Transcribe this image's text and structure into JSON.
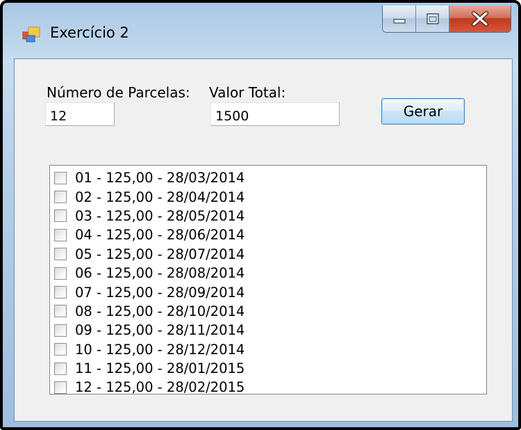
{
  "window": {
    "title": "Exercício 2",
    "icons": {
      "app": "forms-app-icon",
      "minimize": "minimize-icon",
      "maximize": "maximize-icon",
      "close": "close-icon"
    }
  },
  "form": {
    "parcelas_label": "Número de Parcelas:",
    "parcelas_value": "12",
    "valor_label": "Valor Total:",
    "valor_value": "1500",
    "gerar_label": "Gerar"
  },
  "list": {
    "items": [
      {
        "label": "01 - 125,00 - 28/03/2014",
        "checked": false
      },
      {
        "label": "02 - 125,00 - 28/04/2014",
        "checked": false
      },
      {
        "label": "03 - 125,00 - 28/05/2014",
        "checked": false
      },
      {
        "label": "04 - 125,00 - 28/06/2014",
        "checked": false
      },
      {
        "label": "05 - 125,00 - 28/07/2014",
        "checked": false
      },
      {
        "label": "06 - 125,00 - 28/08/2014",
        "checked": false
      },
      {
        "label": "07 - 125,00 - 28/09/2014",
        "checked": false
      },
      {
        "label": "08 - 125,00 - 28/10/2014",
        "checked": false
      },
      {
        "label": "09 - 125,00 - 28/11/2014",
        "checked": false
      },
      {
        "label": "10 - 125,00 - 28/12/2014",
        "checked": false
      },
      {
        "label": "11 - 125,00 - 28/01/2015",
        "checked": false
      },
      {
        "label": "12 - 125,00 - 28/02/2015",
        "checked": false
      }
    ]
  },
  "colors": {
    "button_border": "#3c7fb1",
    "close_button": "#c0391f",
    "client_bg": "#f0f0f0"
  }
}
